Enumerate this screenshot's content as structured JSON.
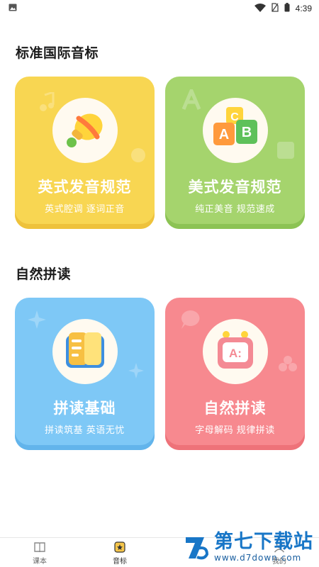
{
  "status_bar": {
    "time": "4:39"
  },
  "sections": {
    "phonetics": {
      "title": "标准国际音标",
      "cards": [
        {
          "title": "英式发音规范",
          "subtitle": "英式腔调 逐词正音",
          "color": "#f8d652",
          "icon": "bell-icon"
        },
        {
          "title": "美式发音规范",
          "subtitle": "纯正美音 规范速成",
          "color": "#a5d46d",
          "icon": "abc-blocks-icon"
        }
      ]
    },
    "phonics": {
      "title": "自然拼读",
      "cards": [
        {
          "title": "拼读基础",
          "subtitle": "拼读筑基 英语无忧",
          "color": "#7ec8f6",
          "icon": "book-icon"
        },
        {
          "title": "自然拼读",
          "subtitle": "字母解码 规律拼读",
          "color": "#f7898f",
          "icon": "robot-tv-icon"
        }
      ]
    }
  },
  "bottom_nav": {
    "items": [
      {
        "label": "课本",
        "icon": "textbook-icon",
        "active": false
      },
      {
        "label": "音标",
        "icon": "phonetic-icon",
        "active": true
      },
      {
        "label": "我的",
        "icon": "profile-icon",
        "active": false
      }
    ]
  },
  "watermark": {
    "brand": "第七下载站",
    "url": "www.d7down.com"
  }
}
